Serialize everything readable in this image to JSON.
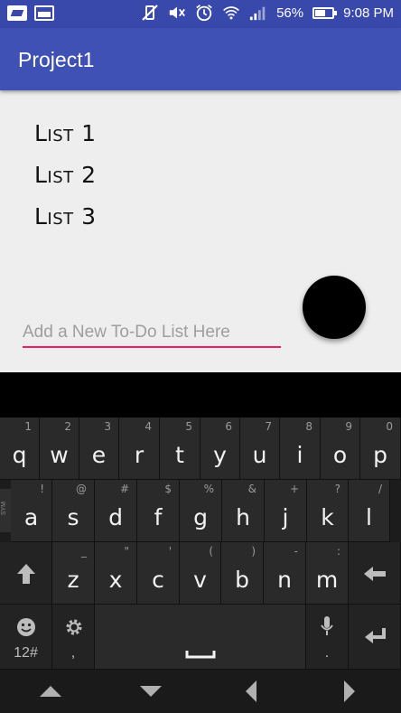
{
  "status_bar": {
    "battery_percent": "56%",
    "time": "9:08 PM",
    "icons": [
      "notification-box-icon",
      "gallery-icon",
      "vibrate-icon",
      "mute-icon",
      "alarm-icon",
      "wifi-icon",
      "signal-icon",
      "battery-icon"
    ]
  },
  "app_bar": {
    "title": "Project1"
  },
  "lists": [
    "List 1",
    "List 2",
    "List 3"
  ],
  "new_list_input": {
    "placeholder": "Add a New To-Do List Here",
    "value": ""
  },
  "fab": {
    "color": "#000000"
  },
  "colors": {
    "primary": "#3f51b5",
    "status_bar": "#3949ab",
    "accent": "#e91e63",
    "background": "#eeeeee"
  },
  "keyboard": {
    "row1": [
      {
        "key": "q",
        "hint": "1"
      },
      {
        "key": "w",
        "hint": "2"
      },
      {
        "key": "e",
        "hint": "3"
      },
      {
        "key": "r",
        "hint": "4"
      },
      {
        "key": "t",
        "hint": "5"
      },
      {
        "key": "y",
        "hint": "6"
      },
      {
        "key": "u",
        "hint": "7"
      },
      {
        "key": "i",
        "hint": "8"
      },
      {
        "key": "o",
        "hint": "9"
      },
      {
        "key": "p",
        "hint": "0"
      }
    ],
    "row2": [
      {
        "key": "a",
        "hint": "!"
      },
      {
        "key": "s",
        "hint": "@"
      },
      {
        "key": "d",
        "hint": "#"
      },
      {
        "key": "f",
        "hint": "$"
      },
      {
        "key": "g",
        "hint": "%"
      },
      {
        "key": "h",
        "hint": "&"
      },
      {
        "key": "j",
        "hint": "+"
      },
      {
        "key": "k",
        "hint": "?"
      },
      {
        "key": "l",
        "hint": "/"
      }
    ],
    "row3": [
      {
        "key": "z",
        "hint": "_"
      },
      {
        "key": "x",
        "hint": "\""
      },
      {
        "key": "c",
        "hint": "'"
      },
      {
        "key": "v",
        "hint": "("
      },
      {
        "key": "b",
        "hint": ")"
      },
      {
        "key": "n",
        "hint": "-"
      },
      {
        "key": "m",
        "hint": ":"
      }
    ],
    "side_tab_label": "SYM",
    "emoji_sub_label": "12#",
    "settings_sub_label": ",",
    "mic_sub_label": "."
  }
}
